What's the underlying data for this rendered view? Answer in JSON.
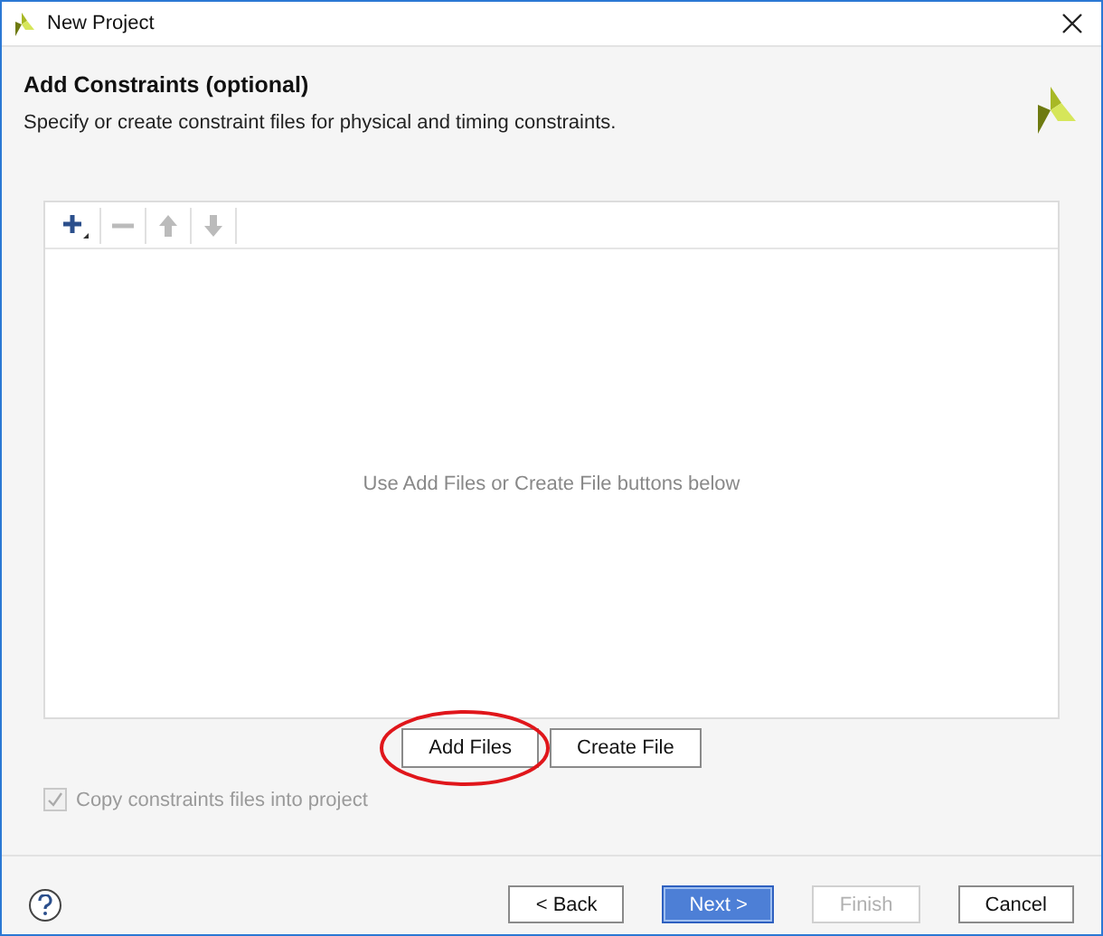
{
  "window": {
    "title": "New Project"
  },
  "header": {
    "title": "Add Constraints (optional)",
    "subtitle": "Specify or create constraint files for physical and timing constraints."
  },
  "toolbar": [
    {
      "kind": "add",
      "disabled": false
    },
    {
      "kind": "remove",
      "disabled": true
    },
    {
      "kind": "up",
      "disabled": true
    },
    {
      "kind": "down",
      "disabled": true
    }
  ],
  "file_list": {
    "empty_message": "Use Add Files or Create File buttons below"
  },
  "list_buttons": [
    {
      "label": "Add Files",
      "highlighted": true
    },
    {
      "label": "Create File",
      "highlighted": false
    }
  ],
  "copy_option": {
    "label": "Copy constraints files into project",
    "checked": true,
    "disabled": true
  },
  "footer_buttons": [
    {
      "label": "< Back",
      "default": false,
      "disabled": false
    },
    {
      "label": "Next >",
      "default": true,
      "disabled": false
    },
    {
      "label": "Finish",
      "default": false,
      "disabled": true
    },
    {
      "label": "Cancel",
      "default": false,
      "disabled": false
    }
  ]
}
